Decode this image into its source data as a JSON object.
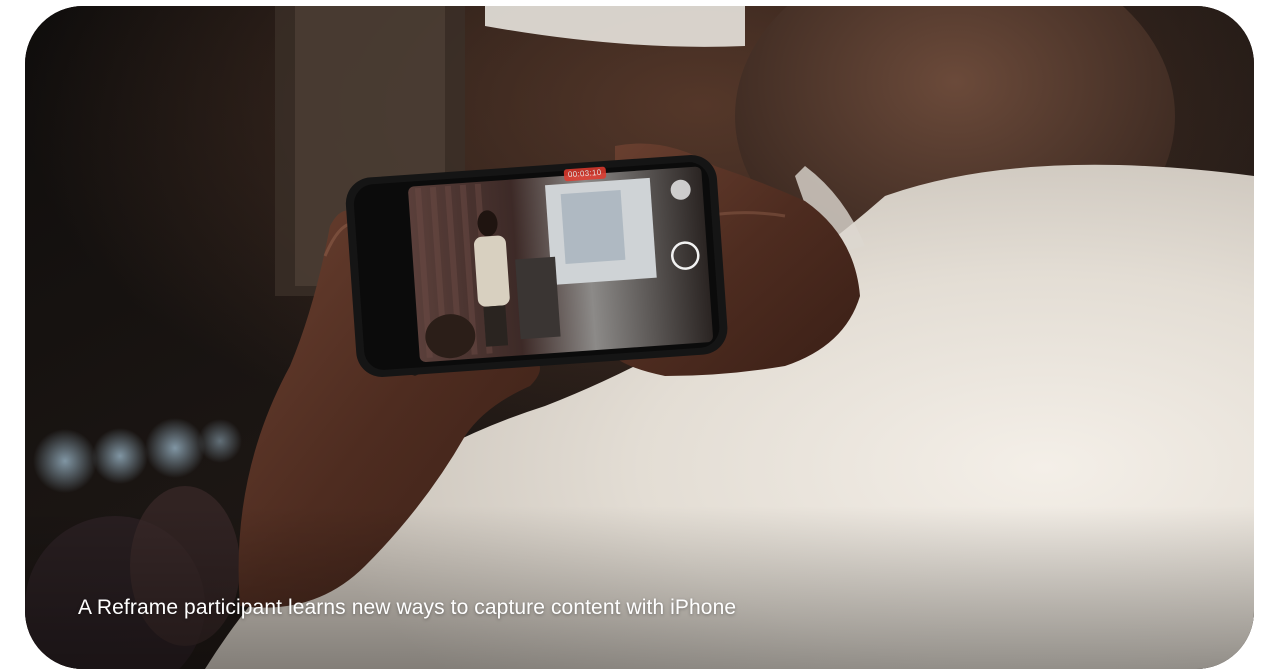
{
  "caption": {
    "text": "A Reframe participant learns new ways to capture content with iPhone"
  },
  "photo": {
    "subject": "person-recording-presenter-with-iphone",
    "recording_badge": "00:03:10"
  },
  "colors": {
    "caption_text": "#ffffff",
    "rec_red": "#e23a2e",
    "card_background": "#1c1512"
  }
}
